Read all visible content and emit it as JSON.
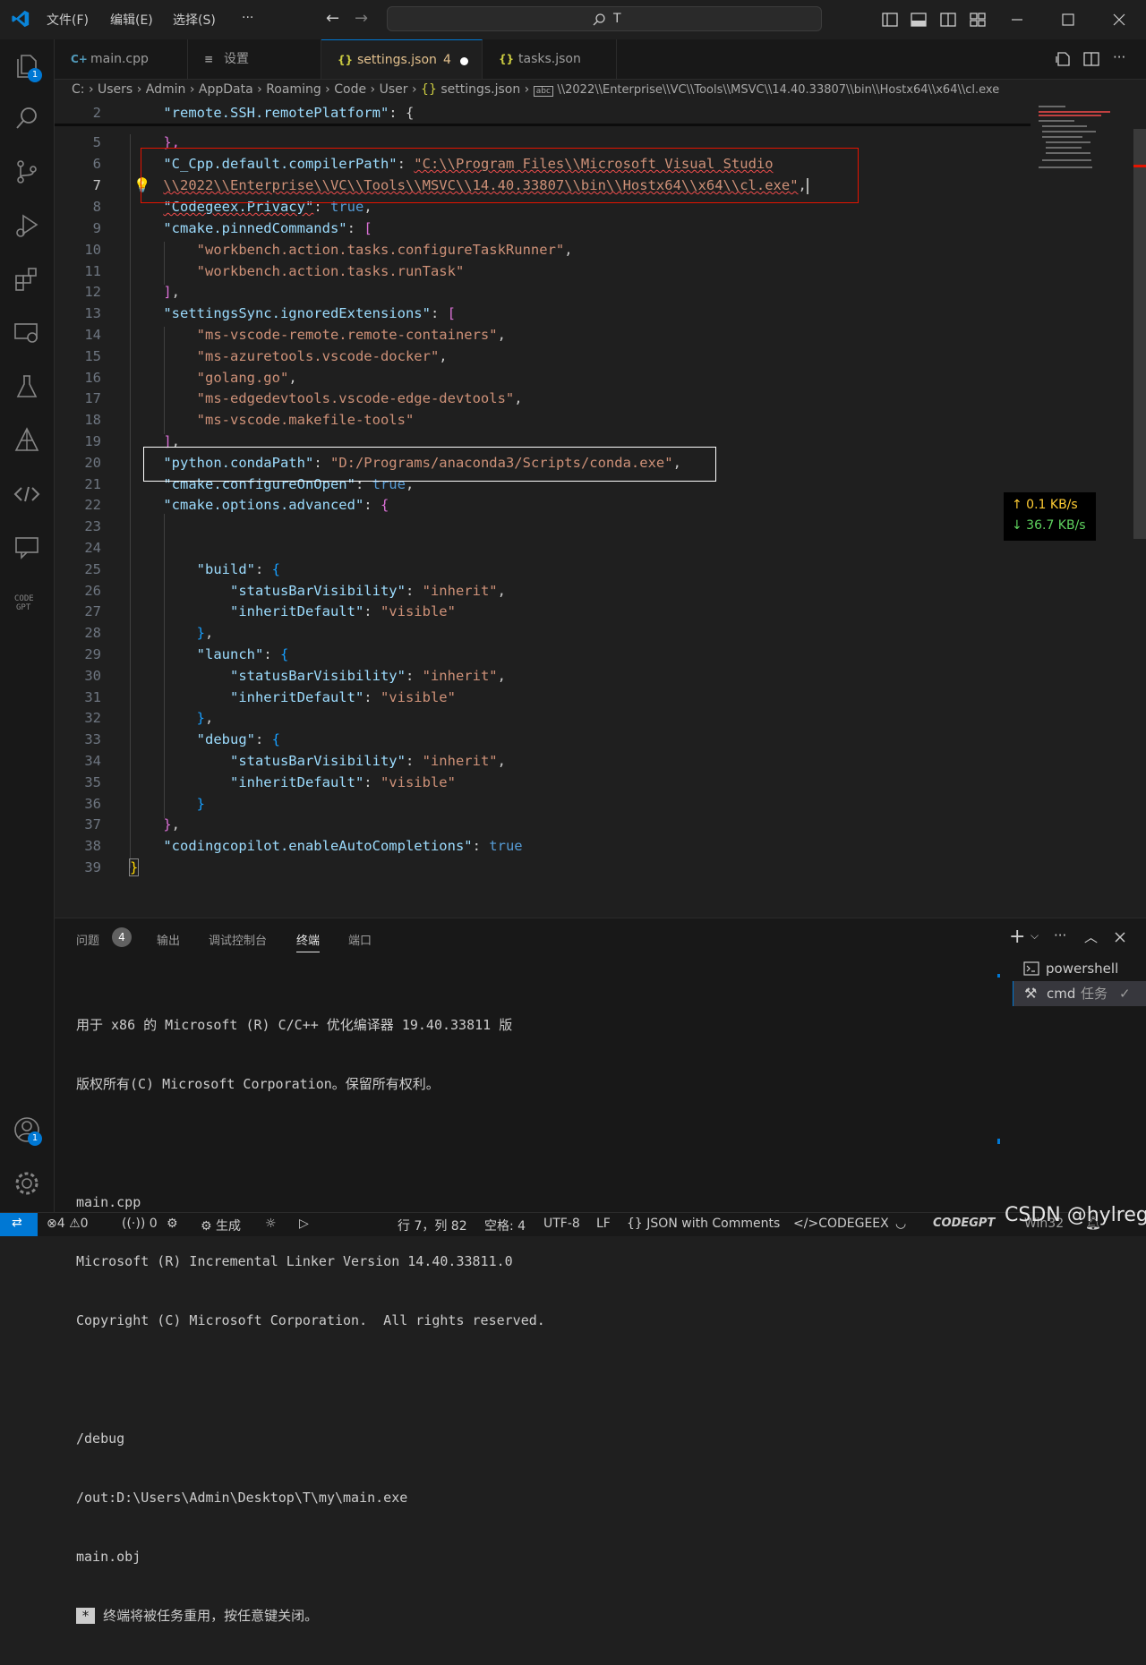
{
  "titlebar": {
    "menus": [
      "文件(F)",
      "编辑(E)",
      "选择(S)",
      "···"
    ],
    "search_text": "T"
  },
  "activity_badges": {
    "explorer": "1",
    "account": "1"
  },
  "tabs": [
    {
      "icon": "C+",
      "label": "main.cpp"
    },
    {
      "icon": "≡",
      "label": "设置"
    },
    {
      "icon": "{}",
      "label": "settings.json",
      "modified": "4"
    },
    {
      "icon": "{}",
      "label": "tasks.json"
    }
  ],
  "breadcrumb": {
    "parts": [
      "C:",
      "Users",
      "Admin",
      "AppData",
      "Roaming",
      "Code",
      "User",
      "settings.json"
    ],
    "last": "\\\\2022\\\\Enterprise\\\\VC\\\\Tools\\\\MSVC\\\\14.40.33807\\\\bin\\\\Hostx64\\\\x64\\\\cl.exe"
  },
  "editor_lines": {
    "l2": {
      "num": "2",
      "key": "\"remote.SSH.remotePlatform\"",
      "rest": ": {"
    },
    "l5": {
      "num": "5",
      "text": "},"
    },
    "l6": {
      "num": "6",
      "key": "\"C_Cpp.default.compilerPath\"",
      "val": "\"C:\\\\Program Files\\\\Microsoft Visual Studio"
    },
    "l7": {
      "num": "7",
      "val": "\\\\2022\\\\Enterprise\\\\VC\\\\Tools\\\\MSVC\\\\14.40.33807\\\\bin\\\\Hostx64\\\\x64\\\\cl.exe\""
    },
    "l8": {
      "num": "8",
      "key": "\"Codegeex.Privacy\"",
      "val": "true"
    },
    "l9": {
      "num": "9",
      "key": "\"cmake.pinnedCommands\""
    },
    "l10": {
      "num": "10",
      "val": "\"workbench.action.tasks.configureTaskRunner\""
    },
    "l11": {
      "num": "11",
      "val": "\"workbench.action.tasks.runTask\""
    },
    "l12": {
      "num": "12"
    },
    "l13": {
      "num": "13",
      "key": "\"settingsSync.ignoredExtensions\""
    },
    "l14": {
      "num": "14",
      "val": "\"ms-vscode-remote.remote-containers\""
    },
    "l15": {
      "num": "15",
      "val": "\"ms-azuretools.vscode-docker\""
    },
    "l16": {
      "num": "16",
      "val": "\"golang.go\""
    },
    "l17": {
      "num": "17",
      "val": "\"ms-edgedevtools.vscode-edge-devtools\""
    },
    "l18": {
      "num": "18",
      "val": "\"ms-vscode.makefile-tools\""
    },
    "l19": {
      "num": "19"
    },
    "l20": {
      "num": "20",
      "key": "\"python.condaPath\"",
      "val": "\"D:/Programs/anaconda3/Scripts/conda.exe\""
    },
    "l21": {
      "num": "21",
      "key": "\"cmake.configureOnOpen\"",
      "val": "true"
    },
    "l22": {
      "num": "22",
      "key": "\"cmake.options.advanced\""
    },
    "l23": {
      "num": "23"
    },
    "l24": {
      "num": "24"
    },
    "l25": {
      "num": "25",
      "key": "\"build\""
    },
    "l26": {
      "num": "26",
      "key": "\"statusBarVisibility\"",
      "val": "\"inherit\""
    },
    "l27": {
      "num": "27",
      "key": "\"inheritDefault\"",
      "val": "\"visible\""
    },
    "l28": {
      "num": "28"
    },
    "l29": {
      "num": "29",
      "key": "\"launch\""
    },
    "l30": {
      "num": "30",
      "key": "\"statusBarVisibility\"",
      "val": "\"inherit\""
    },
    "l31": {
      "num": "31",
      "key": "\"inheritDefault\"",
      "val": "\"visible\""
    },
    "l32": {
      "num": "32"
    },
    "l33": {
      "num": "33",
      "key": "\"debug\""
    },
    "l34": {
      "num": "34",
      "key": "\"statusBarVisibility\"",
      "val": "\"inherit\""
    },
    "l35": {
      "num": "35",
      "key": "\"inheritDefault\"",
      "val": "\"visible\""
    },
    "l36": {
      "num": "36"
    },
    "l37": {
      "num": "37"
    },
    "l38": {
      "num": "38",
      "key": "\"codingcopilot.enableAutoCompletions\"",
      "val": "true"
    },
    "l39": {
      "num": "39"
    }
  },
  "net_speed": {
    "up": "↑ 0.1 KB/s",
    "down": "↓ 36.7 KB/s"
  },
  "panel": {
    "tabs": [
      "问题",
      "输出",
      "调试控制台",
      "终端",
      "端口"
    ],
    "problems_count": "4",
    "terminal_lines": [
      "用于 x86 的 Microsoft (R) C/C++ 优化编译器 19.40.33811 版",
      "版权所有(C) Microsoft Corporation。保留所有权利。",
      "",
      "main.cpp",
      "Microsoft (R) Incremental Linker Version 14.40.33811.0",
      "Copyright (C) Microsoft Corporation.  All rights reserved.",
      "",
      "/debug",
      "/out:D:\\Users\\Admin\\Desktop\\T\\my\\main.exe",
      "main.obj"
    ],
    "terminal_last_marker": "*",
    "terminal_last": "终端将被任务重用，按任意键关闭。",
    "terminals": [
      {
        "label": "powershell"
      },
      {
        "label": "cmd",
        "sub": "任务"
      }
    ]
  },
  "statusbar": {
    "errors": "4",
    "warnings": "0",
    "ports": "0",
    "build": "生成",
    "position": "行 7，列 82",
    "spaces": "空格: 4",
    "encoding": "UTF-8",
    "eol": "LF",
    "language": "JSON with Comments",
    "codegeex": "CODEGEEX",
    "codegpt": "CODEGPT",
    "win32": "Win32",
    "watermark": "CSDN @hylreg"
  },
  "colors": {
    "accent": "#0078d4",
    "keyword": "#9cdcfe",
    "string": "#ce9178",
    "bool": "#569cd6",
    "highlight_red": "#e51400"
  }
}
